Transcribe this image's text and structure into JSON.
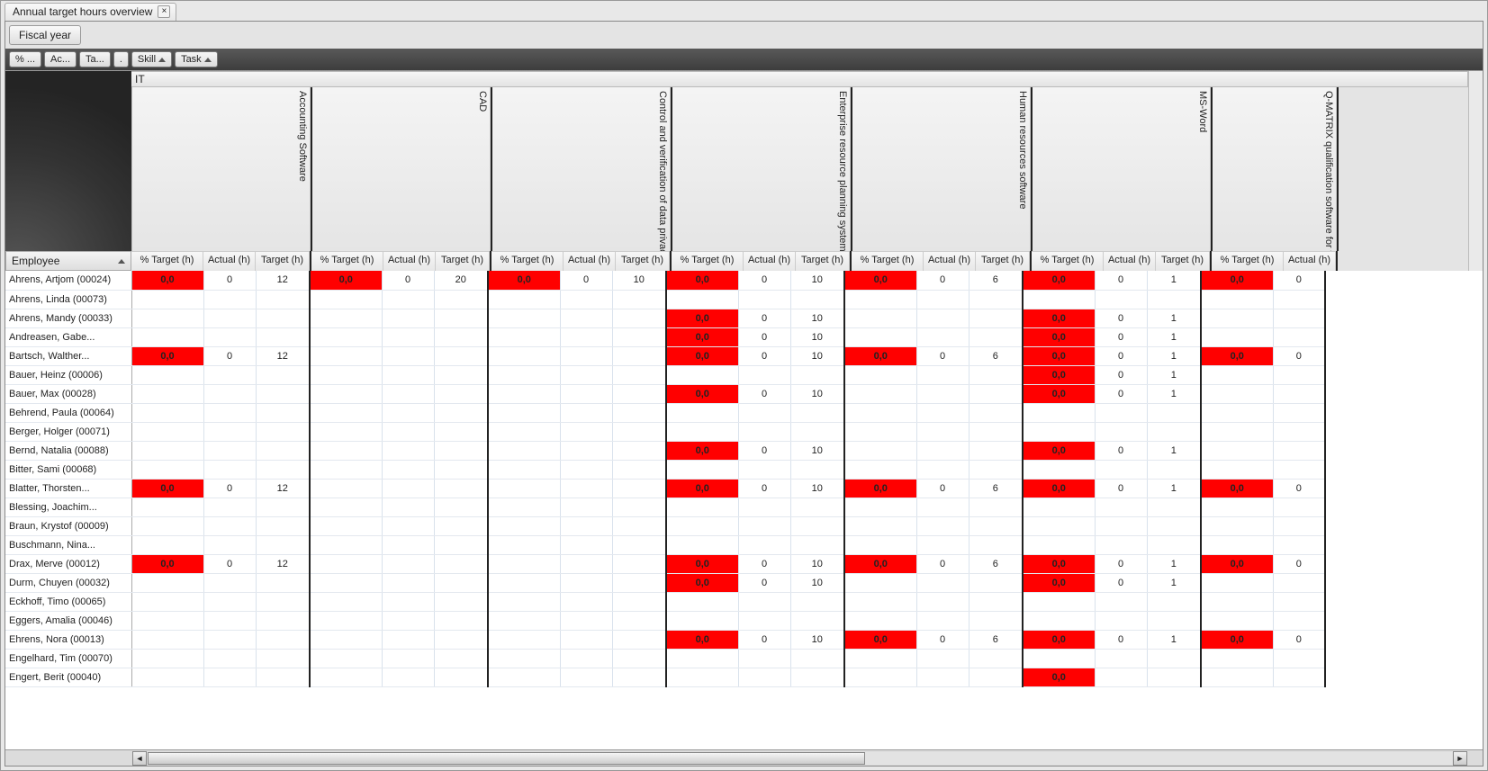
{
  "tab": {
    "title": "Annual target hours overview"
  },
  "toolbar": {
    "fiscal_year": "Fiscal year"
  },
  "filters": {
    "pct": "% ...",
    "ac": "Ac...",
    "ta": "Ta...",
    "dot": ".",
    "skill": "Skill",
    "task": "Task"
  },
  "band_label": "IT",
  "subcols": [
    "% Target (h)",
    "Actual (h)",
    "Target (h)"
  ],
  "subcols_last": [
    "% Target (h)",
    "Actual (h)"
  ],
  "employee_header": "Employee",
  "colwidths": {
    "pct": 80,
    "actual": 58,
    "target": 60
  },
  "skills": [
    "Accounting Software",
    "CAD",
    "Control and verification of data privacy",
    "Enterprise resource planning system",
    "Human resources software",
    "MS-Word",
    "Q-MATRIX qualification software for workforce"
  ],
  "employees": [
    "Ahrens, Artjom (00024)",
    "Ahrens, Linda (00073)",
    "Ahrens, Mandy (00033)",
    "Andreasen, Gabe...",
    "Bartsch, Walther...",
    "Bauer, Heinz (00006)",
    "Bauer, Max (00028)",
    "Behrend, Paula (00064)",
    "Berger, Holger (00071)",
    "Bernd, Natalia (00088)",
    "Bitter, Sami (00068)",
    "Blatter, Thorsten...",
    "Blessing, Joachim...",
    "Braun, Krystof (00009)",
    "Buschmann, Nina...",
    "Drax, Merve (00012)",
    "Durm, Chuyen (00032)",
    "Eckhoff, Timo (00065)",
    "Eggers, Amalia (00046)",
    "Ehrens, Nora (00013)",
    "Engelhard, Tim (00070)",
    "Engert, Berit (00040)"
  ],
  "rows": [
    [
      [
        "0,0",
        "0",
        "12"
      ],
      [
        "0,0",
        "0",
        "20"
      ],
      [
        "0,0",
        "0",
        "10"
      ],
      [
        "0,0",
        "0",
        "10"
      ],
      [
        "0,0",
        "0",
        "6"
      ],
      [
        "0,0",
        "0",
        "1"
      ],
      [
        "0,0",
        "0",
        ""
      ]
    ],
    [
      [
        "",
        "",
        ""
      ],
      [
        "",
        "",
        ""
      ],
      [
        "",
        "",
        ""
      ],
      [
        "",
        "",
        ""
      ],
      [
        "",
        "",
        ""
      ],
      [
        "",
        "",
        ""
      ],
      [
        "",
        "",
        ""
      ]
    ],
    [
      [
        "",
        "",
        ""
      ],
      [
        "",
        "",
        ""
      ],
      [
        "",
        "",
        ""
      ],
      [
        "0,0",
        "0",
        "10"
      ],
      [
        "",
        "",
        ""
      ],
      [
        "0,0",
        "0",
        "1"
      ],
      [
        "",
        "",
        ""
      ]
    ],
    [
      [
        "",
        "",
        ""
      ],
      [
        "",
        "",
        ""
      ],
      [
        "",
        "",
        ""
      ],
      [
        "0,0",
        "0",
        "10"
      ],
      [
        "",
        "",
        ""
      ],
      [
        "0,0",
        "0",
        "1"
      ],
      [
        "",
        "",
        ""
      ]
    ],
    [
      [
        "0,0",
        "0",
        "12"
      ],
      [
        "",
        "",
        ""
      ],
      [
        "",
        "",
        ""
      ],
      [
        "0,0",
        "0",
        "10"
      ],
      [
        "0,0",
        "0",
        "6"
      ],
      [
        "0,0",
        "0",
        "1"
      ],
      [
        "0,0",
        "0",
        ""
      ]
    ],
    [
      [
        "",
        "",
        ""
      ],
      [
        "",
        "",
        ""
      ],
      [
        "",
        "",
        ""
      ],
      [
        "",
        "",
        ""
      ],
      [
        "",
        "",
        ""
      ],
      [
        "0,0",
        "0",
        "1"
      ],
      [
        "",
        "",
        ""
      ]
    ],
    [
      [
        "",
        "",
        ""
      ],
      [
        "",
        "",
        ""
      ],
      [
        "",
        "",
        ""
      ],
      [
        "0,0",
        "0",
        "10"
      ],
      [
        "",
        "",
        ""
      ],
      [
        "0,0",
        "0",
        "1"
      ],
      [
        "",
        "",
        ""
      ]
    ],
    [
      [
        "",
        "",
        ""
      ],
      [
        "",
        "",
        ""
      ],
      [
        "",
        "",
        ""
      ],
      [
        "",
        "",
        ""
      ],
      [
        "",
        "",
        ""
      ],
      [
        "",
        "",
        ""
      ],
      [
        "",
        "",
        ""
      ]
    ],
    [
      [
        "",
        "",
        ""
      ],
      [
        "",
        "",
        ""
      ],
      [
        "",
        "",
        ""
      ],
      [
        "",
        "",
        ""
      ],
      [
        "",
        "",
        ""
      ],
      [
        "",
        "",
        ""
      ],
      [
        "",
        "",
        ""
      ]
    ],
    [
      [
        "",
        "",
        ""
      ],
      [
        "",
        "",
        ""
      ],
      [
        "",
        "",
        ""
      ],
      [
        "0,0",
        "0",
        "10"
      ],
      [
        "",
        "",
        ""
      ],
      [
        "0,0",
        "0",
        "1"
      ],
      [
        "",
        "",
        ""
      ]
    ],
    [
      [
        "",
        "",
        ""
      ],
      [
        "",
        "",
        ""
      ],
      [
        "",
        "",
        ""
      ],
      [
        "",
        "",
        ""
      ],
      [
        "",
        "",
        ""
      ],
      [
        "",
        "",
        ""
      ],
      [
        "",
        "",
        ""
      ]
    ],
    [
      [
        "0,0",
        "0",
        "12"
      ],
      [
        "",
        "",
        ""
      ],
      [
        "",
        "",
        ""
      ],
      [
        "0,0",
        "0",
        "10"
      ],
      [
        "0,0",
        "0",
        "6"
      ],
      [
        "0,0",
        "0",
        "1"
      ],
      [
        "0,0",
        "0",
        ""
      ]
    ],
    [
      [
        "",
        "",
        ""
      ],
      [
        "",
        "",
        ""
      ],
      [
        "",
        "",
        ""
      ],
      [
        "",
        "",
        ""
      ],
      [
        "",
        "",
        ""
      ],
      [
        "",
        "",
        ""
      ],
      [
        "",
        "",
        ""
      ]
    ],
    [
      [
        "",
        "",
        ""
      ],
      [
        "",
        "",
        ""
      ],
      [
        "",
        "",
        ""
      ],
      [
        "",
        "",
        ""
      ],
      [
        "",
        "",
        ""
      ],
      [
        "",
        "",
        ""
      ],
      [
        "",
        "",
        ""
      ]
    ],
    [
      [
        "",
        "",
        ""
      ],
      [
        "",
        "",
        ""
      ],
      [
        "",
        "",
        ""
      ],
      [
        "",
        "",
        ""
      ],
      [
        "",
        "",
        ""
      ],
      [
        "",
        "",
        ""
      ],
      [
        "",
        "",
        ""
      ]
    ],
    [
      [
        "0,0",
        "0",
        "12"
      ],
      [
        "",
        "",
        ""
      ],
      [
        "",
        "",
        ""
      ],
      [
        "0,0",
        "0",
        "10"
      ],
      [
        "0,0",
        "0",
        "6"
      ],
      [
        "0,0",
        "0",
        "1"
      ],
      [
        "0,0",
        "0",
        ""
      ]
    ],
    [
      [
        "",
        "",
        ""
      ],
      [
        "",
        "",
        ""
      ],
      [
        "",
        "",
        ""
      ],
      [
        "0,0",
        "0",
        "10"
      ],
      [
        "",
        "",
        ""
      ],
      [
        "0,0",
        "0",
        "1"
      ],
      [
        "",
        "",
        ""
      ]
    ],
    [
      [
        "",
        "",
        ""
      ],
      [
        "",
        "",
        ""
      ],
      [
        "",
        "",
        ""
      ],
      [
        "",
        "",
        ""
      ],
      [
        "",
        "",
        ""
      ],
      [
        "",
        "",
        ""
      ],
      [
        "",
        "",
        ""
      ]
    ],
    [
      [
        "",
        "",
        ""
      ],
      [
        "",
        "",
        ""
      ],
      [
        "",
        "",
        ""
      ],
      [
        "",
        "",
        ""
      ],
      [
        "",
        "",
        ""
      ],
      [
        "",
        "",
        ""
      ],
      [
        "",
        "",
        ""
      ]
    ],
    [
      [
        "",
        "",
        ""
      ],
      [
        "",
        "",
        ""
      ],
      [
        "",
        "",
        ""
      ],
      [
        "0,0",
        "0",
        "10"
      ],
      [
        "0,0",
        "0",
        "6"
      ],
      [
        "0,0",
        "0",
        "1"
      ],
      [
        "0,0",
        "0",
        ""
      ]
    ],
    [
      [
        "",
        "",
        ""
      ],
      [
        "",
        "",
        ""
      ],
      [
        "",
        "",
        ""
      ],
      [
        "",
        "",
        ""
      ],
      [
        "",
        "",
        ""
      ],
      [
        "",
        "",
        ""
      ],
      [
        "",
        "",
        ""
      ]
    ],
    [
      [
        "",
        "",
        ""
      ],
      [
        "",
        "",
        ""
      ],
      [
        "",
        "",
        ""
      ],
      [
        "",
        "",
        ""
      ],
      [
        "",
        "",
        ""
      ],
      [
        "0,0",
        "",
        ""
      ],
      [
        "",
        "",
        ""
      ]
    ]
  ]
}
